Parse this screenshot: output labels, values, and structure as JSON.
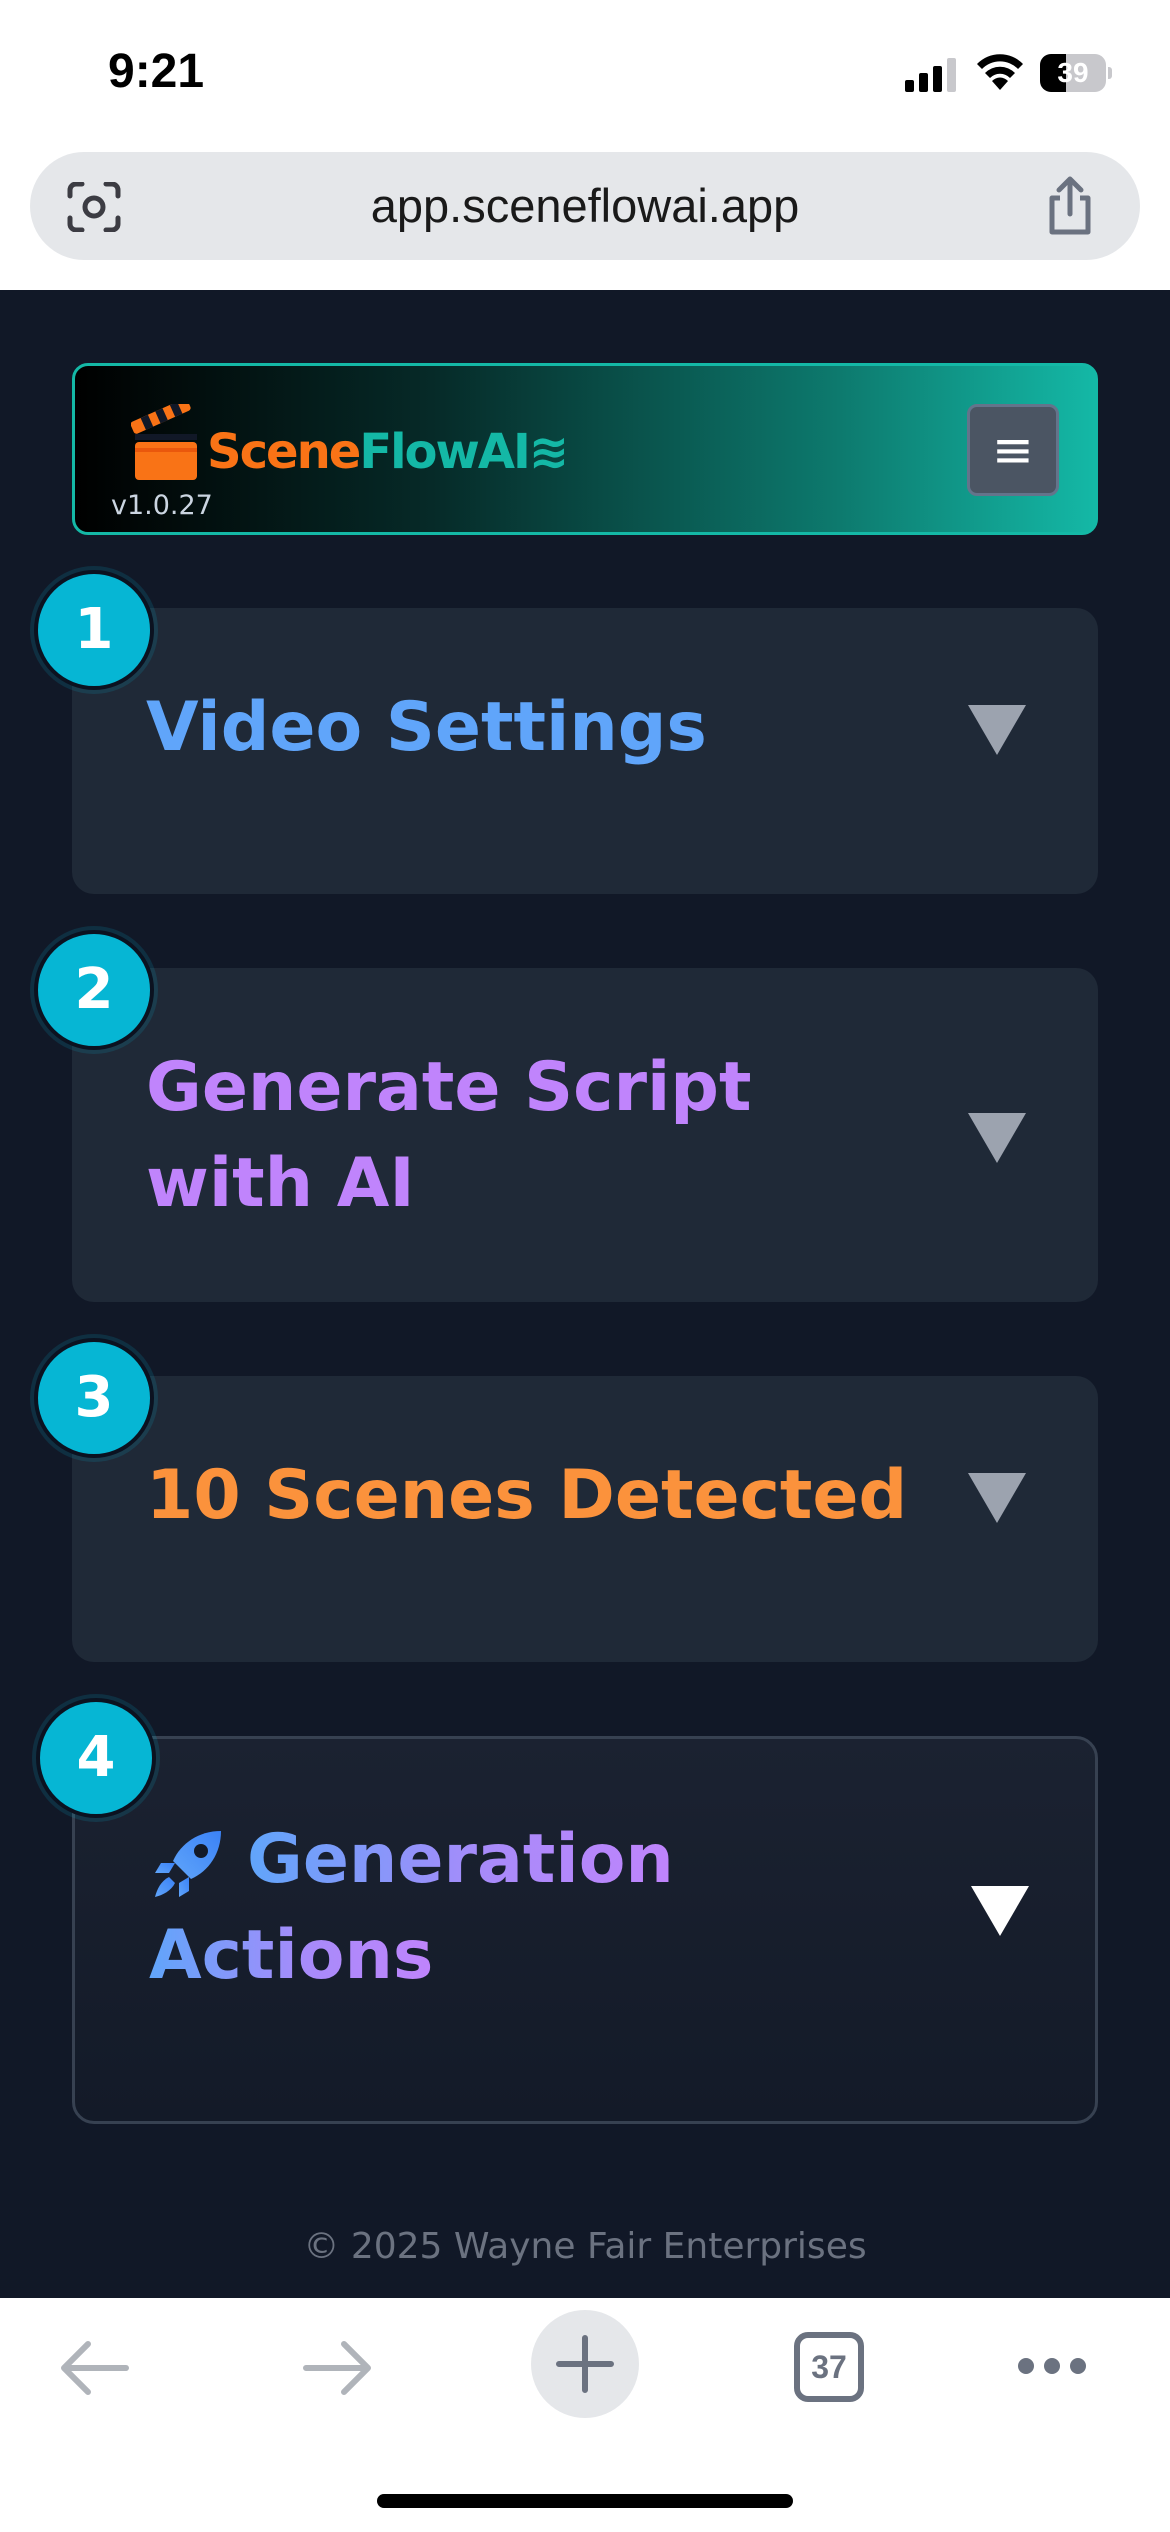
{
  "status_bar": {
    "time": "9:21",
    "battery_level": "39",
    "icons": [
      "signal-icon",
      "wifi-icon",
      "battery-icon"
    ]
  },
  "url_bar": {
    "url": "app.sceneflowai.app",
    "icons": [
      "camera-scan-icon",
      "share-icon"
    ]
  },
  "header": {
    "logo_part1": "Scene",
    "logo_part2": "FlowAI",
    "logo_suffix": "≋",
    "version": "v1.0.27",
    "menu_icon": "≡"
  },
  "steps": [
    {
      "number": "1",
      "title_line1": "Video Settings",
      "title_line2": "",
      "color": "#60a5fa"
    },
    {
      "number": "2",
      "title_line1": "Generate Script",
      "title_line2": "with AI",
      "color": "#c084fc"
    },
    {
      "number": "3",
      "title_line1": "10 Scenes Detected",
      "title_line2": "",
      "color": "#fb923c"
    },
    {
      "number": "4",
      "title_line1": "Generation",
      "title_line2": "Actions",
      "icon": "rocket-icon",
      "color": "#60a5fa"
    }
  ],
  "footer": {
    "text": "© 2025 Wayne Fair Enterprises"
  },
  "toolbar": {
    "tab_count": "37",
    "icons": [
      "back-arrow-icon",
      "forward-arrow-icon",
      "new-tab-plus-icon",
      "tabs-icon",
      "more-icon"
    ]
  },
  "colors": {
    "app_background": "#111827",
    "card_background": "#1f2937",
    "step_badge": "#06b6d4",
    "header_accent": "#14b8a6",
    "brand_orange": "#f97316"
  }
}
